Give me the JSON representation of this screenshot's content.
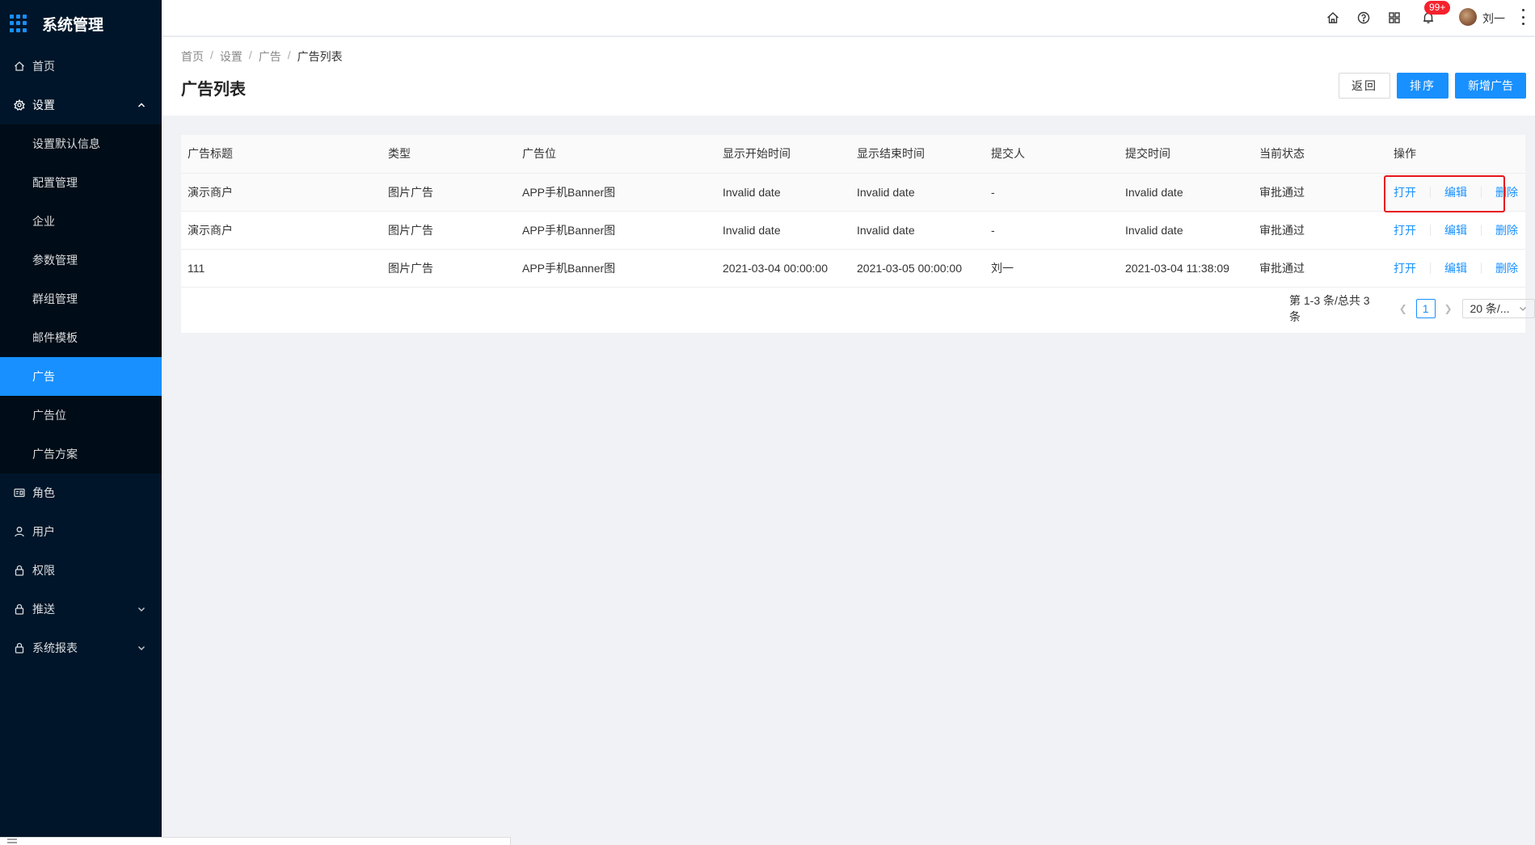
{
  "app": {
    "title": "系统管理"
  },
  "sidebar": {
    "items": [
      {
        "label": "首页",
        "icon": "home-icon"
      },
      {
        "label": "设置",
        "icon": "gear-icon",
        "expanded": true,
        "children": [
          {
            "label": "设置默认信息"
          },
          {
            "label": "配置管理"
          },
          {
            "label": "企业"
          },
          {
            "label": "参数管理"
          },
          {
            "label": "群组管理"
          },
          {
            "label": "邮件模板"
          },
          {
            "label": "广告",
            "active": true
          },
          {
            "label": "广告位"
          },
          {
            "label": "广告方案"
          }
        ]
      },
      {
        "label": "角色",
        "icon": "id-card-icon"
      },
      {
        "label": "用户",
        "icon": "user-icon"
      },
      {
        "label": "权限",
        "icon": "lock-icon"
      },
      {
        "label": "推送",
        "icon": "lock-icon",
        "collapsible": true
      },
      {
        "label": "系统报表",
        "icon": "lock-icon",
        "collapsible": true
      }
    ]
  },
  "header": {
    "notification_badge": "99+",
    "username": "刘一"
  },
  "breadcrumb": [
    "首页",
    "设置",
    "广告",
    "广告列表"
  ],
  "page": {
    "title": "广告列表"
  },
  "actions": {
    "back": "返回",
    "sort": "排序",
    "add": "新增广告"
  },
  "table": {
    "columns": [
      "广告标题",
      "类型",
      "广告位",
      "显示开始时间",
      "显示结束时间",
      "提交人",
      "提交时间",
      "当前状态",
      "操作"
    ],
    "rows": [
      [
        "演示商户",
        "图片广告",
        "APP手机Banner图",
        "Invalid date",
        "Invalid date",
        "-",
        "Invalid date",
        "审批通过"
      ],
      [
        "演示商户",
        "图片广告",
        "APP手机Banner图",
        "Invalid date",
        "Invalid date",
        "-",
        "Invalid date",
        "审批通过"
      ],
      [
        "111",
        "图片广告",
        "APP手机Banner图",
        "2021-03-04 00:00:00",
        "2021-03-05 00:00:00",
        "刘一",
        "2021-03-04 11:38:09",
        "审批通过"
      ]
    ],
    "row_actions": [
      "打开",
      "编辑",
      "删除"
    ]
  },
  "pagination": {
    "summary": "第 1-3 条/总共 3 条",
    "current": "1",
    "page_size": "20 条/..."
  },
  "colors": {
    "sidebar_bg": "#001529",
    "primary": "#1890ff",
    "highlight": "#e8161d"
  }
}
